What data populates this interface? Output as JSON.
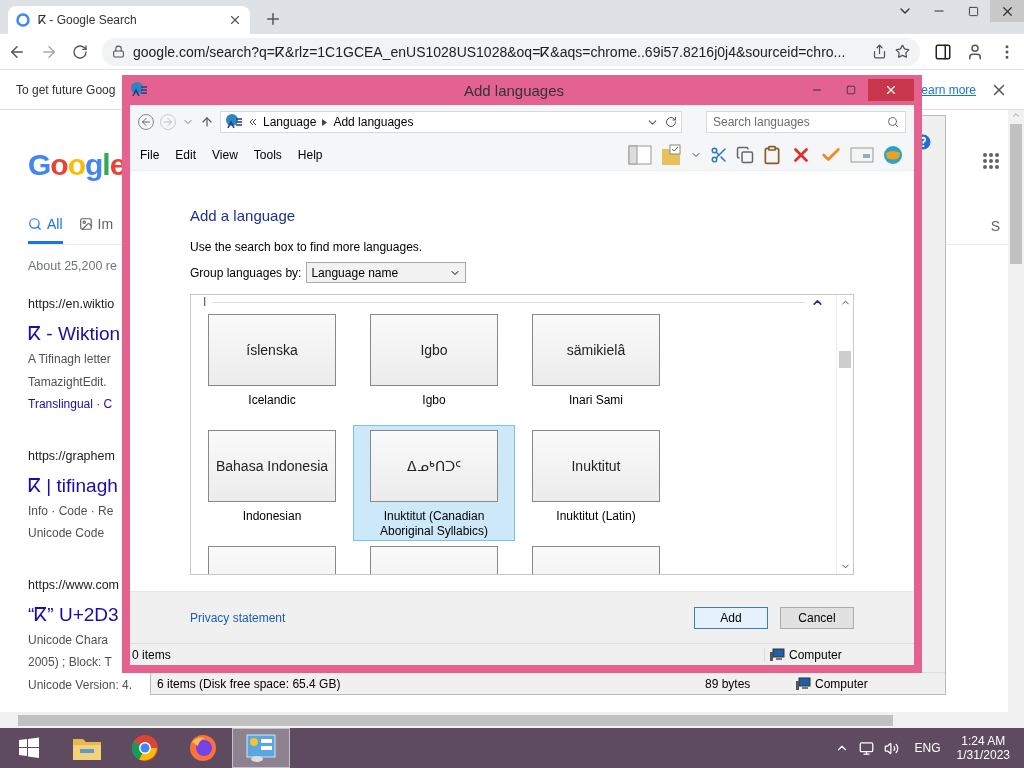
{
  "browser": {
    "tabs": [
      {
        "title": "ⴽ - Google Search",
        "selected": true
      }
    ],
    "address": "google.com/search?q=ⴽ&rlz=1C1GCEA_enUS1028US1028&oq=ⴽ&aqs=chrome..69i57.8216j0j4&sourceid=chro...",
    "infobar": {
      "text": "To get future Goog",
      "link": "earn more"
    }
  },
  "google": {
    "logo": "Google",
    "tabs": [
      {
        "label": "All",
        "selected": true
      },
      {
        "label": "Im",
        "selected": false
      }
    ],
    "right_tab": "S",
    "result_count": "About 25,200 re",
    "results": [
      {
        "url": "https://en.wiktio",
        "title": "ⴽ - Wiktion",
        "lines": [
          {
            "kind": "text",
            "text": "A Tifinagh letter"
          },
          {
            "kind": "text",
            "text": "TamazightEdit."
          },
          {
            "kind": "link",
            "text": "Translingual · C"
          }
        ]
      },
      {
        "url": "https://graphem",
        "title": "ⴽ | tifinagh",
        "lines": [
          {
            "kind": "text",
            "text": "Info · Code · Re"
          },
          {
            "kind": "text",
            "text": "Unicode Code"
          }
        ]
      },
      {
        "url": "https://www.com",
        "title": "“ⴽ” U+2D3",
        "lines": [
          {
            "kind": "text",
            "text": "Unicode Chara"
          },
          {
            "kind": "text",
            "text": "2005) ; Block: T"
          },
          {
            "kind": "text",
            "text": "Unicode Version: 4."
          }
        ]
      }
    ]
  },
  "background_window": {
    "status": [
      "6 items (Disk free space: 65.4 GB)",
      "89 bytes",
      "Computer"
    ]
  },
  "dialog": {
    "title": "Add languages",
    "breadcrumb": [
      "Language",
      "Add languages"
    ],
    "search": {
      "placeholder": "Search languages"
    },
    "menu": [
      "File",
      "Edit",
      "View",
      "Tools",
      "Help"
    ],
    "heading": "Add a language",
    "hint": "Use the search box to find more languages.",
    "group_by": {
      "label": "Group languages by:",
      "value": "Language name"
    },
    "group": "I",
    "tiles": [
      {
        "kind": "tile",
        "native": "íslenska",
        "name": "Icelandic",
        "selected": false
      },
      {
        "kind": "tile",
        "native": "Igbo",
        "name": "Igbo",
        "selected": false
      },
      {
        "kind": "tile",
        "native": "sämikielâ",
        "name": "Inari Sami",
        "selected": false
      },
      {
        "kind": "tile",
        "native": "Bahasa Indonesia",
        "name": "Indonesian",
        "selected": false
      },
      {
        "kind": "tile",
        "native": "ᐃᓄᒃᑎᑐᑦ",
        "name": "Inuktitut (Canadian Aboriginal Syllabics)",
        "selected": true
      },
      {
        "kind": "tile",
        "native": "Inuktitut",
        "name": "Inuktitut (Latin)",
        "selected": false
      },
      {
        "kind": "cut"
      },
      {
        "kind": "cut"
      },
      {
        "kind": "cut"
      }
    ],
    "privacy": "Privacy statement",
    "buttons": [
      {
        "label": "Add",
        "selected": true
      },
      {
        "label": "Cancel",
        "selected": false
      }
    ],
    "status": [
      "0 items",
      "Computer"
    ]
  },
  "taskbar": {
    "apps": [
      {
        "kind": "explorer",
        "selected": false
      },
      {
        "kind": "chrome",
        "selected": false
      },
      {
        "kind": "firefox",
        "selected": false
      },
      {
        "kind": "control",
        "selected": true
      }
    ],
    "language": "ENG",
    "time": "1:24 AM",
    "date": "1/31/2023"
  }
}
